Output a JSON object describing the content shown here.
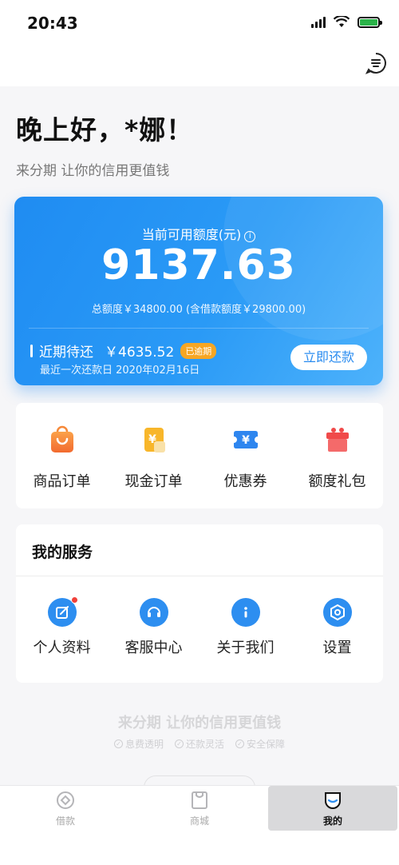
{
  "status_bar": {
    "time": "20:43"
  },
  "greeting": "晚上好，*娜！",
  "slogan": "来分期 让你的信用更值钱",
  "credit": {
    "label": "当前可用额度(元)",
    "info_icon": "i",
    "available": "9137.63",
    "total_line": "总额度￥34800.00 (含借款额度￥29800.00)",
    "due_label": "近期待还",
    "due_amount": "￥4635.52",
    "due_badge": "已逾期",
    "last_payment": "最近一次还款日 2020年02月16日",
    "repay_button": "立即还款"
  },
  "orders": [
    {
      "label": "商品订单",
      "icon": "shopping-bag-icon"
    },
    {
      "label": "现金订单",
      "icon": "cash-order-icon"
    },
    {
      "label": "优惠券",
      "icon": "coupon-icon"
    },
    {
      "label": "额度礼包",
      "icon": "gift-icon"
    }
  ],
  "services": {
    "title": "我的服务",
    "items": [
      {
        "label": "个人资料",
        "icon": "edit-profile-icon"
      },
      {
        "label": "客服中心",
        "icon": "headset-icon"
      },
      {
        "label": "关于我们",
        "icon": "info-icon"
      },
      {
        "label": "设置",
        "icon": "settings-icon"
      }
    ]
  },
  "footer": {
    "slogan": "来分期 让你的信用更值钱",
    "tags": [
      "息费透明",
      "还款灵活",
      "安全保障"
    ]
  },
  "tabs": [
    {
      "label": "借款",
      "icon": "loan-icon",
      "active": false
    },
    {
      "label": "商城",
      "icon": "mall-icon",
      "active": false
    },
    {
      "label": "我的",
      "icon": "me-icon",
      "active": true
    }
  ],
  "colors": {
    "primary": "#2d8ef0",
    "badge": "#f6a623",
    "orange": "#f7893b",
    "red": "#f0413a"
  }
}
